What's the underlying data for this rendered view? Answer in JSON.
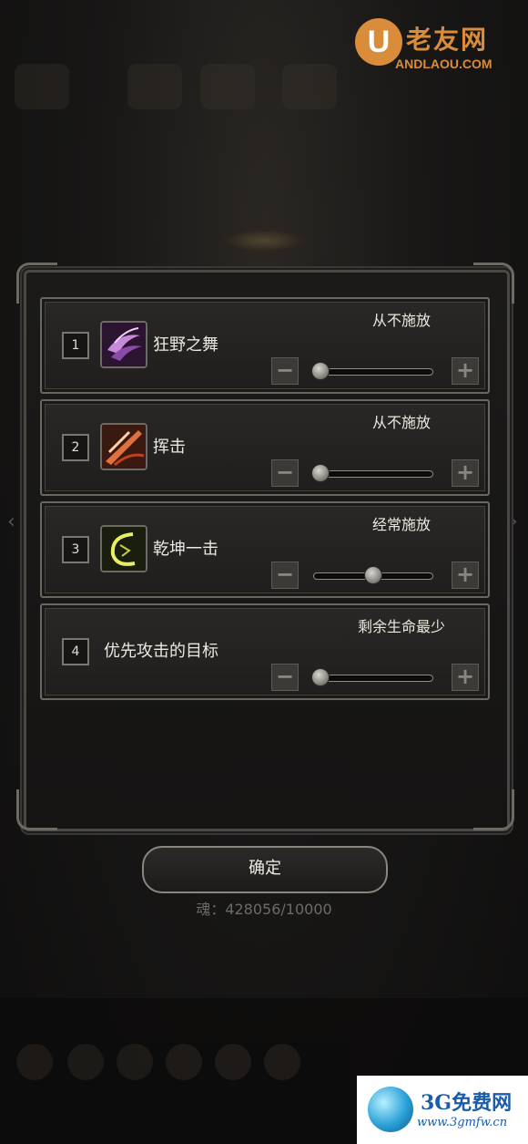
{
  "watermark_top": {
    "logo_letter": "U",
    "name": "老友网",
    "domain": "ANDLAOU.COM"
  },
  "skills": [
    {
      "num": "1",
      "name": "狂野之舞",
      "setting": "从不施放",
      "level": 0.0,
      "icon": "wild-dance-icon"
    },
    {
      "num": "2",
      "name": "挥击",
      "setting": "从不施放",
      "level": 0.0,
      "icon": "swing-strike-icon"
    },
    {
      "num": "3",
      "name": "乾坤一击",
      "setting": "经常施放",
      "level": 0.5,
      "icon": "qiankun-strike-icon"
    },
    {
      "num": "4",
      "name": "优先攻击的目标",
      "setting": "剩余生命最少",
      "level": 0.0,
      "icon": null
    }
  ],
  "controls": {
    "minus": "−",
    "plus": "+"
  },
  "confirm_label": "确定",
  "soul_text": "魂：428056/10000",
  "watermark_bottom": {
    "name": "3G免费网",
    "domain": "www.3gmfw.cn"
  },
  "colors": {
    "accent_watermark": "#d98d3a",
    "panel_border": "#6a6760",
    "background": "#141313"
  }
}
